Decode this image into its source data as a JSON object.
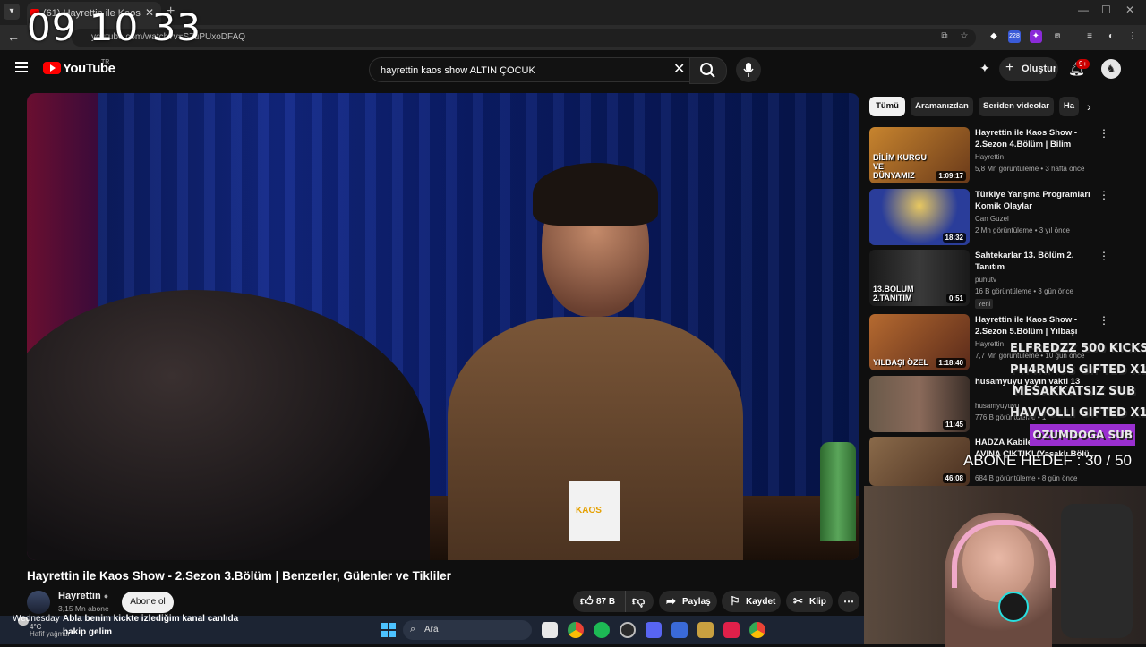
{
  "clock": "09 10 33",
  "browser": {
    "tab_title": "(61) Hayrettin ile Kaos Show -",
    "url": "youtube.com/watch?v=S7uPUxoDFAQ",
    "new_tab": "+",
    "extension_badge": "228"
  },
  "youtube": {
    "logo_text": "YouTube",
    "country": "TR",
    "search_query": "hayrettin kaos show ALTIN ÇOCUK",
    "create_label": "Oluştur",
    "notification_count": "9+"
  },
  "video": {
    "title": "Hayrettin ile Kaos Show - 2.Sezon 3.Bölüm | Benzerler, Gülenler ve Tikliler",
    "channel": "Hayrettin",
    "subscribers": "3,15 Mn abone",
    "subscribe_label": "Abone ol",
    "likes": "87 B",
    "share_label": "Paylaş",
    "save_label": "Kaydet",
    "clip_label": "Klip",
    "mug_text": "KAOS"
  },
  "chips": [
    "Tümü",
    "Aramanızdan",
    "Seriden videolar",
    "Ha"
  ],
  "recommendations": [
    {
      "title": "Hayrettin ile Kaos Show - 2.Sezon 4.Bölüm | Bilim Kurgu...",
      "channel": "Hayrettin",
      "meta": "5,8 Mn görüntüleme • 3 hafta önce",
      "duration": "1:09:17",
      "caption": "BİLİM KURGU VE DÜNYAMIZ",
      "color": "#b5762e"
    },
    {
      "title": "Türkiye Yarışma Programları Komik Olaylar",
      "channel": "Can Guzel",
      "meta": "2 Mn görüntüleme • 3 yıl önce",
      "duration": "18:32",
      "caption": "",
      "color": "#2a3d9a"
    },
    {
      "title": "Sahtekarlar 13. Bölüm 2. Tanıtım",
      "channel": "puhutv",
      "meta": "16 B görüntüleme • 3 gün önce",
      "duration": "0:51",
      "caption": "13.BÖLÜM 2.TANITIM",
      "color": "#2a2a2a",
      "badge": "Yeni"
    },
    {
      "title": "Hayrettin ile Kaos Show - 2.Sezon 5.Bölüm | Yılbaşı Özel...",
      "channel": "Hayrettin",
      "meta": "7,7 Mn görüntüleme • 10 gün önce",
      "duration": "1:18:40",
      "caption": "YILBAŞI ÖZEL",
      "color": "#9a5a2a"
    },
    {
      "title": "husamyuyu yayın vakti 13",
      "channel": "husamyuyuyu",
      "meta": "776 B görüntüleme • 1",
      "duration": "11:45",
      "caption": "",
      "color": "#4a3a32"
    },
    {
      "title": "HADZA Kabilesi ile MAYMUN AVINA ÇIKTIK! (Yasaklı Bölü...",
      "channel": "",
      "meta": "684 B görüntüleme • 8 gün önce",
      "duration": "46:08",
      "caption": "",
      "color": "#7a5a3a"
    }
  ],
  "stream": {
    "alerts": [
      "ELFREDZZ 500 KICKS",
      "PH4RMUS GIFTED X1",
      "MESAKKATSIZ SUB",
      "HAVVOLLI GIFTED X1",
      "OZUMDOGA SUB"
    ],
    "goal": "ABONE HEDEF : 30 / 50"
  },
  "taskbar": {
    "weather_day": "Wednesday",
    "weather_temp": "4°C",
    "weather_desc": "Hafif yağmur",
    "chat_line1": "Abla benim kickte izlediğim kanal canlıda",
    "chat_line2": "bakip gelim",
    "search_label": "Ara"
  },
  "colors": {
    "youtube_red": "#ff0000",
    "background": "#0f0f0f",
    "alert_highlight": "#9a2fd0"
  }
}
